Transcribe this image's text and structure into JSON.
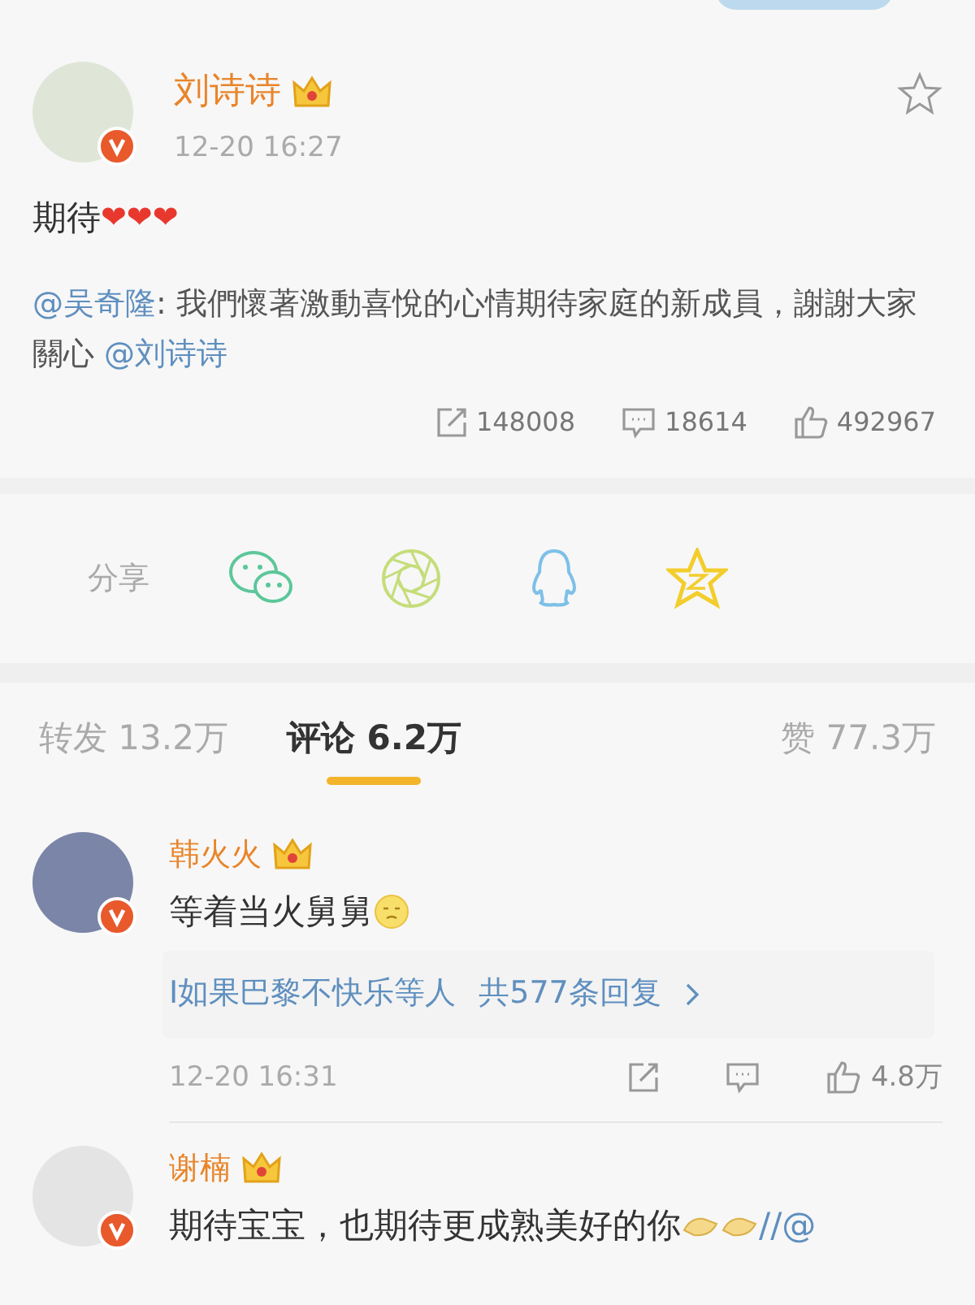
{
  "post": {
    "author": "刘诗诗",
    "time": "12-20 16:27",
    "text": "期待",
    "hearts": "❤❤❤",
    "repost": {
      "mention": "@吴奇隆",
      "text": ": 我們懷著激動喜悅的心情期待家庭的新成員，謝謝大家關心 ",
      "mention_end": "@刘诗诗"
    },
    "stats": [
      {
        "kind": "repost",
        "count": "148008"
      },
      {
        "kind": "comment",
        "count": "18614"
      },
      {
        "kind": "like",
        "count": "492967"
      }
    ]
  },
  "share": {
    "label": "分享",
    "targets": [
      {
        "kind": "wechat"
      },
      {
        "kind": "moments"
      },
      {
        "kind": "qq"
      },
      {
        "kind": "qzone"
      }
    ]
  },
  "tabs": [
    {
      "label": "转发 13.2万",
      "selected": false
    },
    {
      "label": "评论 6.2万",
      "selected": true
    },
    {
      "label": "赞 77.3万",
      "selected": false
    }
  ],
  "comments": [
    {
      "author": "韩火火",
      "segments": [
        {
          "kind": "text",
          "text": "等着当火舅舅"
        },
        {
          "kind": "emoji"
        }
      ],
      "replies": {
        "names": "I如果巴黎不快乐等人",
        "count": "共577条回复"
      },
      "time": "12-20 16:31",
      "likes": "4.8万"
    },
    {
      "author": "谢楠",
      "segments": [
        {
          "kind": "text",
          "text": "期待宝宝，也期待更成熟美好的你"
        },
        {
          "kind": "clap"
        },
        {
          "kind": "clap"
        },
        {
          "kind": "link",
          "text": "//@"
        }
      ]
    }
  ]
}
